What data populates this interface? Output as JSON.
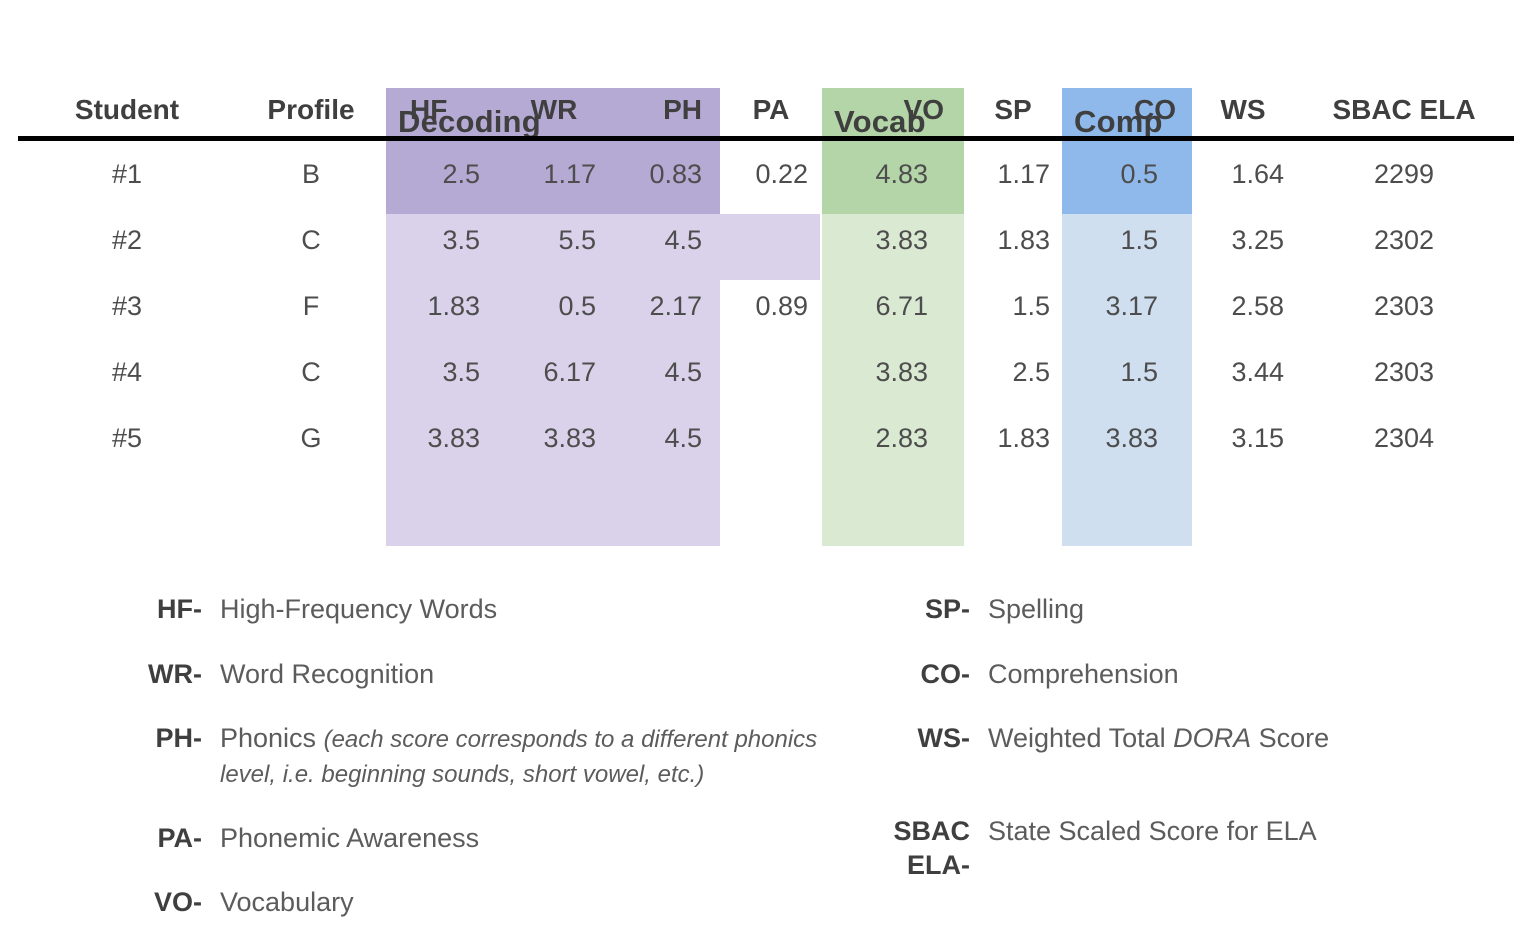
{
  "table": {
    "column_groups": [
      {
        "name": "Decoding",
        "label": "Decoding",
        "columns": [
          "HF",
          "WR",
          "PH"
        ],
        "header_color": "#b5aad4",
        "body_color": "#dad2ea"
      },
      {
        "name": "Vocab",
        "label": "Vocab",
        "columns": [
          "VO"
        ],
        "header_color": "#b4d5a8",
        "body_color": "#d9e9d2"
      },
      {
        "name": "Comp",
        "label": "Comp",
        "columns": [
          "CO"
        ],
        "header_color": "#8fb9ea",
        "body_color": "#cfdff0"
      }
    ],
    "headers": {
      "student": "Student",
      "profile": "Profile",
      "hf": "HF",
      "wr": "WR",
      "ph": "PH",
      "pa": "PA",
      "vo": "VO",
      "sp": "SP",
      "co": "CO",
      "ws": "WS",
      "sbac": "SBAC ELA"
    },
    "rows": [
      {
        "student": "#1",
        "profile": "B",
        "hf": "2.5",
        "wr": "1.17",
        "ph": "0.83",
        "pa": "0.22",
        "vo": "4.83",
        "sp": "1.17",
        "co": "0.5",
        "ws": "1.64",
        "sbac": "2299"
      },
      {
        "student": "#2",
        "profile": "C",
        "hf": "3.5",
        "wr": "5.5",
        "ph": "4.5",
        "pa": "",
        "vo": "3.83",
        "sp": "1.83",
        "co": "1.5",
        "ws": "3.25",
        "sbac": "2302"
      },
      {
        "student": "#3",
        "profile": "F",
        "hf": "1.83",
        "wr": "0.5",
        "ph": "2.17",
        "pa": "0.89",
        "vo": "6.71",
        "sp": "1.5",
        "co": "3.17",
        "ws": "2.58",
        "sbac": "2303"
      },
      {
        "student": "#4",
        "profile": "C",
        "hf": "3.5",
        "wr": "6.17",
        "ph": "4.5",
        "pa": "",
        "vo": "3.83",
        "sp": "2.5",
        "co": "1.5",
        "ws": "3.44",
        "sbac": "2303"
      },
      {
        "student": "#5",
        "profile": "G",
        "hf": "3.83",
        "wr": "3.83",
        "ph": "4.5",
        "pa": "",
        "vo": "2.83",
        "sp": "1.83",
        "co": "3.83",
        "ws": "3.15",
        "sbac": "2304"
      }
    ]
  },
  "legend": {
    "left": [
      {
        "abbr": "HF-",
        "text": "High-Frequency Words"
      },
      {
        "abbr": "WR-",
        "text": "Word Recognition"
      },
      {
        "abbr": "PH-",
        "text": "Phonics",
        "note": "(each score corresponds to a different phonics level, i.e. beginning sounds, short vowel, etc.)"
      },
      {
        "abbr": "PA-",
        "text": "Phonemic Awareness"
      },
      {
        "abbr": "VO-",
        "text": "Vocabulary"
      }
    ],
    "right": [
      {
        "abbr": "SP-",
        "text": "Spelling"
      },
      {
        "abbr": "CO-",
        "text": "Comprehension"
      },
      {
        "abbr": "WS-",
        "text_before": "Weighted Total ",
        "em": "DORA",
        "text_after": " Score"
      },
      {
        "abbr": "SBAC\nELA-",
        "text": "State Scaled Score for ELA"
      }
    ]
  },
  "colors": {
    "decoding_header": "#b5aad4",
    "decoding_body": "#dad2ea",
    "vocab_header": "#b4d5a8",
    "vocab_body": "#d9e9d2",
    "comp_header": "#8fb9ea",
    "comp_body": "#cfdff0",
    "rule": "#000000",
    "header_text": "#3f3f3f",
    "body_text": "#4d4d4d"
  },
  "chart_data": {
    "type": "table",
    "title": "",
    "categories": [
      "#1",
      "#2",
      "#3",
      "#4",
      "#5"
    ],
    "series": [
      {
        "name": "HF",
        "values": [
          2.5,
          3.5,
          1.83,
          3.5,
          3.83
        ]
      },
      {
        "name": "WR",
        "values": [
          1.17,
          5.5,
          0.5,
          6.17,
          3.83
        ]
      },
      {
        "name": "PH",
        "values": [
          0.83,
          4.5,
          2.17,
          4.5,
          4.5
        ]
      },
      {
        "name": "PA",
        "values": [
          0.22,
          null,
          0.89,
          null,
          null
        ]
      },
      {
        "name": "VO",
        "values": [
          4.83,
          3.83,
          6.71,
          3.83,
          2.83
        ]
      },
      {
        "name": "SP",
        "values": [
          1.17,
          1.83,
          1.5,
          2.5,
          1.83
        ]
      },
      {
        "name": "CO",
        "values": [
          0.5,
          1.5,
          3.17,
          1.5,
          3.83
        ]
      },
      {
        "name": "WS",
        "values": [
          1.64,
          3.25,
          2.58,
          3.44,
          3.15
        ]
      },
      {
        "name": "SBAC ELA",
        "values": [
          2299,
          2302,
          2303,
          2303,
          2304
        ]
      }
    ],
    "profiles": [
      "B",
      "C",
      "F",
      "C",
      "G"
    ],
    "xlabel": "Student",
    "ylabel": ""
  }
}
